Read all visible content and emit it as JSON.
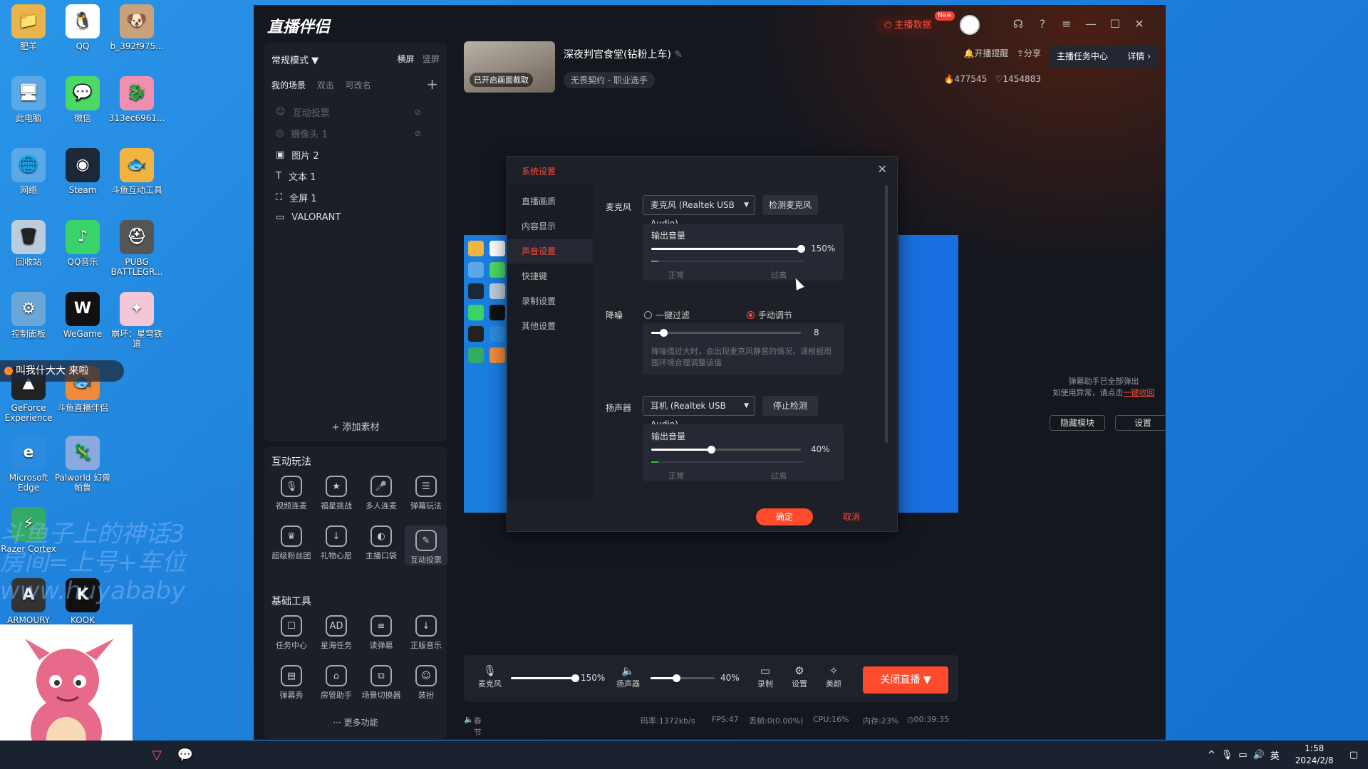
{
  "desktop": {
    "icons": [
      {
        "label": "肥羊",
        "glyph": "📁"
      },
      {
        "label": "QQ",
        "glyph": "🐧"
      },
      {
        "label": "b_392f975...",
        "glyph": "🐶"
      },
      {
        "label": "此电脑",
        "glyph": "🖥"
      },
      {
        "label": "微信",
        "glyph": "💬"
      },
      {
        "label": "313ec6961...",
        "glyph": "🐉"
      },
      {
        "label": "网络",
        "glyph": "🌐"
      },
      {
        "label": "Steam",
        "glyph": "◉"
      },
      {
        "label": "斗鱼互动工具",
        "glyph": "🐟"
      },
      {
        "label": "回收站",
        "glyph": "🗑"
      },
      {
        "label": "QQ音乐",
        "glyph": "♪"
      },
      {
        "label": "PUBG BATTLEGR...",
        "glyph": "⛑"
      },
      {
        "label": "控制面板",
        "glyph": "⚙"
      },
      {
        "label": "WeGame",
        "glyph": "W"
      },
      {
        "label": "崩坏：星穹铁道",
        "glyph": "✦"
      },
      {
        "label": "GeForce Experience",
        "glyph": "▲"
      },
      {
        "label": "斗鱼直播伴侣",
        "glyph": "🐟"
      },
      {
        "label": "Microsoft Edge",
        "glyph": "e"
      },
      {
        "label": "Palworld 幻兽帕鲁",
        "glyph": "🦎"
      },
      {
        "label": "Razer Cortex",
        "glyph": "⚡"
      },
      {
        "label": "ARMOURY",
        "glyph": "A"
      },
      {
        "label": "KOOK",
        "glyph": "K"
      }
    ],
    "danmu_text": "叫我什大大  来啦",
    "watermark_1": "斗鱼子上的神话3",
    "watermark_2": "房间=上号+车位",
    "watermark_3": "www.huyababy"
  },
  "taskbar": {
    "time": "1:58",
    "date": "2024/2/8",
    "ime": "英"
  },
  "app": {
    "logo": "直播伴侣",
    "header_data": "主播数据",
    "new_badge": "New",
    "room": {
      "title": "深夜判官食堂(钻粉上车)",
      "thumb_caption": "已开启画面截取",
      "category": "无畏契约 - 职业选手",
      "remind": "开播提醒",
      "share": "分享",
      "hot": "477545",
      "follows": "1454883"
    },
    "task_center": {
      "label": "主播任务中心",
      "detail": "详情"
    },
    "scene": {
      "mode": "常规模式",
      "orient_h": "横屏",
      "orient_v": "竖屏",
      "tabs": [
        "我的场景",
        "双击",
        "可改名"
      ],
      "sources": [
        {
          "label": "互动投票",
          "glyph": "☺"
        },
        {
          "label": "摄像头 1",
          "glyph": "◎"
        },
        {
          "label": "图片 2",
          "glyph": "▣"
        },
        {
          "label": "文本 1",
          "glyph": "T"
        },
        {
          "label": "全屏 1",
          "glyph": "⛶"
        },
        {
          "label": "VALORANT",
          "glyph": "▭"
        }
      ],
      "add_material": "添加素材"
    },
    "interactive": {
      "title": "互动玩法",
      "tools": [
        {
          "label": "视频连麦",
          "glyph": "🎙"
        },
        {
          "label": "福星挑战",
          "glyph": "★"
        },
        {
          "label": "多人连麦",
          "glyph": "🎤"
        },
        {
          "label": "弹幕玩法",
          "glyph": "☰"
        },
        {
          "label": "超级粉丝团",
          "glyph": "♛"
        },
        {
          "label": "礼物心愿",
          "glyph": "↓"
        },
        {
          "label": "主播口袋",
          "glyph": "◐"
        },
        {
          "label": "互动投票",
          "glyph": "✎"
        }
      ]
    },
    "basic": {
      "title": "基础工具",
      "tools": [
        {
          "label": "任务中心",
          "glyph": "☐"
        },
        {
          "label": "星海任务",
          "glyph": "AD"
        },
        {
          "label": "读弹幕",
          "glyph": "≡"
        },
        {
          "label": "正版音乐",
          "glyph": "↓"
        },
        {
          "label": "弹幕秀",
          "glyph": "▤"
        },
        {
          "label": "房管助手",
          "glyph": "⌂"
        },
        {
          "label": "场景切换器",
          "glyph": "⧉"
        },
        {
          "label": "装扮",
          "glyph": "☺"
        }
      ],
      "more": "更多功能"
    },
    "danmu_panel": {
      "note": "弹幕助手已全部弹出",
      "note2": "如使用异常，请点击",
      "recall": "一键收回",
      "hide": "隐藏模块",
      "settings": "设置"
    },
    "bottom": {
      "mic_label": "麦克风",
      "mic_pct": "150%",
      "mic_level": 1.0,
      "spk_label": "扬声器",
      "spk_pct": "40%",
      "spk_level": 0.4,
      "record": "录制",
      "settings": "设置",
      "beauty": "美颜",
      "close_live": "关闭直播"
    },
    "status": {
      "promo": "春节福袋主播福利",
      "bitrate": "码率:1372kb/s",
      "fps": "FPS:47",
      "drop": "丢帧:0(0.00%)",
      "cpu": "CPU:16%",
      "mem": "内存:23%",
      "time": "00:39:35"
    }
  },
  "dialog": {
    "title": "系统设置",
    "nav": [
      "直播画质",
      "内容显示",
      "声音设置",
      "快捷键",
      "录制设置",
      "其他设置"
    ],
    "active_nav": "声音设置",
    "mic": {
      "label": "麦克风",
      "device": "麦克风 (Realtek USB Audio)",
      "test_btn": "检测麦克风",
      "out_label": "输出音量",
      "pct": "150%",
      "level": 1.0,
      "normal": "正常",
      "high": "过高"
    },
    "noise": {
      "label": "降噪",
      "opt1": "一键过滤",
      "opt2": "手动调节",
      "selected": "手动调节",
      "value": "8",
      "level": 0.08,
      "hint": "降噪值过大时，会出现麦克风静音的情况，请根据周围环境合理调整该值"
    },
    "speaker": {
      "label": "扬声器",
      "device": "耳机 (Realtek USB Audio)",
      "stop_btn": "停止检测",
      "out_label": "输出音量",
      "pct": "40%",
      "level": 0.4,
      "normal": "正常",
      "high": "过高"
    },
    "ok": "确定",
    "cancel": "取消"
  }
}
